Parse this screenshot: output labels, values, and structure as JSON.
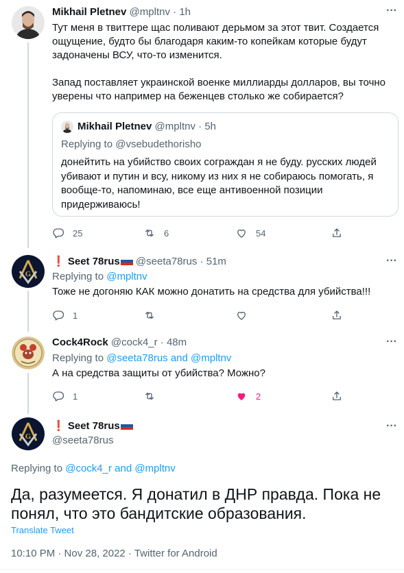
{
  "tweet1": {
    "name": "Mikhail Pletnev",
    "handle": "@mpltnv",
    "sep": "·",
    "time": "1h",
    "text": "Тут меня в твиттере щас поливают дерьмом за этот твит. Создается ощущение, будто бы благодаря каким-то копейкам которые будут задоначены ВСУ, что-то изменится.\n\nЗапад поставляет украинской военке миллиарды долларов, вы точно уверены что например на беженцев столько же собирается?",
    "quote": {
      "name": "Mikhail Pletnev",
      "handle": "@mpltnv",
      "sep": "·",
      "time": "5h",
      "replying_prefix": "Replying to",
      "replying_to": "@vsebudethorisho",
      "text": "донейтить на убийство своих сограждан я не буду. русских людей убивают и путин и всу, никому из них я не собираюсь помогать, я вообще-то, напоминаю, все еще антивоенной позиции придерживаюсь!"
    },
    "replies": "25",
    "retweets": "6",
    "likes": "54"
  },
  "tweet2": {
    "excl": "❗",
    "name": "Seet 78rus",
    "handle": "@seeta78rus",
    "sep": "·",
    "time": "51m",
    "replying_prefix": "Replying to",
    "replying_to": "@mpltnv",
    "text": "Тоже не догоняю КАК можно донатить на средства для убийства!!!",
    "replies": "1"
  },
  "tweet3": {
    "name": "Cock4Rock",
    "handle": "@cock4_r",
    "sep": "·",
    "time": "48m",
    "replying_prefix": "Replying to",
    "replying_to": "@seeta78rus and @mpltnv",
    "text": "А на средства защиты от убийства? Можно?",
    "replies": "1",
    "likes": "2",
    "like_color": "#f91880"
  },
  "focus": {
    "excl": "❗",
    "name": "Seet 78rus",
    "handle": "@seeta78rus",
    "replying_prefix": "Replying to",
    "replying_to": "@cock4_r and @mpltnv",
    "text": "Да, разумеется. Я донатил в ДНР правда. Пока не понял, что это бандитские образования.",
    "translate": "Translate Tweet",
    "timestamp": "10:10 PM · Nov 28, 2022 · Twitter for Android"
  },
  "colors": {
    "accent": "#1d9bf0",
    "secondary_text": "#536471",
    "border": "#cfd9de"
  },
  "icons": [
    "reply-icon",
    "retweet-icon",
    "like-icon",
    "share-icon",
    "more-icon"
  ]
}
